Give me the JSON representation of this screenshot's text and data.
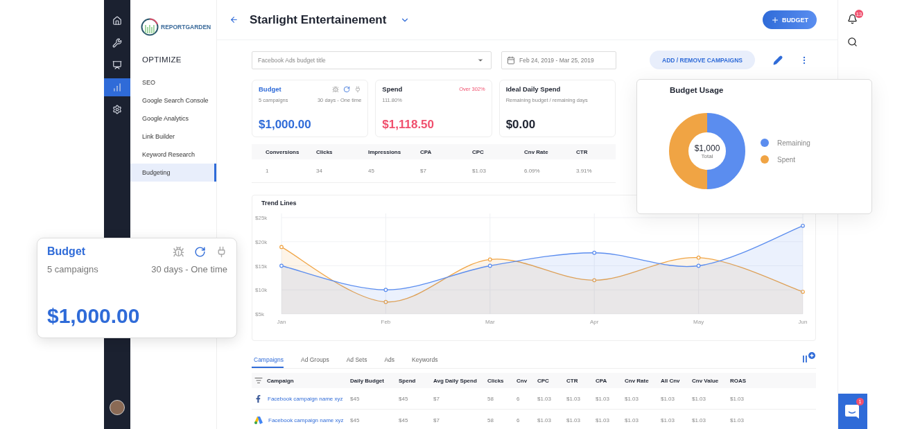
{
  "rail": {
    "items": [
      {
        "kind": "home",
        "selected": false
      },
      {
        "kind": "tools",
        "selected": false
      },
      {
        "kind": "reports",
        "selected": false
      },
      {
        "kind": "optimize",
        "selected": true
      },
      {
        "kind": "settings",
        "selected": false
      }
    ]
  },
  "brand": {
    "name": "REPORTGARDEN"
  },
  "sidebar": {
    "heading": "OPTIMIZE",
    "items": [
      {
        "label": "SEO",
        "selected": false
      },
      {
        "label": "Google Search Console",
        "selected": false
      },
      {
        "label": "Google Analytics",
        "selected": false
      },
      {
        "label": "Link Builder",
        "selected": false
      },
      {
        "label": "Keyword Research",
        "selected": false
      },
      {
        "label": "Budgeting",
        "selected": true
      }
    ]
  },
  "header": {
    "title": "Starlight Entertainement",
    "add_button": "BUDGET"
  },
  "toolbar": {
    "budget_select": {
      "placeholder": "Facebook Ads budget title"
    },
    "date_range": "Feb 24, 2019 - Mar 25, 2019",
    "campaigns_button": "ADD / REMOVE CAMPAIGNS"
  },
  "cards": [
    {
      "kind": "budget",
      "title": "Budget",
      "subtitle": "5 campaigns",
      "note": "30 days - One time",
      "value": "$1,000.00"
    },
    {
      "kind": "spend",
      "title": "Spend",
      "subtitle": "111.80%",
      "note": "Over 302%",
      "value": "$1,118.50"
    },
    {
      "kind": "ideal",
      "title": "Ideal Daily Spend",
      "subtitle": "Remaining budget / remaining days",
      "value": "$0.00"
    }
  ],
  "metrics": {
    "columns": [
      "Conversions",
      "Clicks",
      "Impressions",
      "CPA",
      "CPC",
      "Cnv Rate",
      "CTR"
    ],
    "row": [
      "1",
      "34",
      "45",
      "$7",
      "$1.03",
      "6.09%",
      "3.91%"
    ]
  },
  "trend": {
    "title": "Trend Lines",
    "chart_data": {
      "type": "area",
      "categories": [
        "Jan",
        "Feb",
        "Mar",
        "Apr",
        "May",
        "Jun"
      ],
      "series": [
        {
          "color": "#f0a444",
          "values": [
            18.9,
            7.5,
            16.3,
            12,
            16.7,
            9.6
          ]
        },
        {
          "color": "#5b8def",
          "values": [
            15,
            10,
            15,
            17.7,
            15,
            23.3
          ]
        }
      ],
      "ylim": [
        5,
        25
      ],
      "grid": true,
      "yticks": [
        {
          "value": 5,
          "label": "$5k"
        },
        {
          "value": 10,
          "label": "$10k"
        },
        {
          "value": 15,
          "label": "$15k"
        },
        {
          "value": 20,
          "label": "$20k"
        },
        {
          "value": 25,
          "label": "$25k"
        }
      ]
    }
  },
  "tabs": [
    {
      "label": "Campaigns",
      "selected": true
    },
    {
      "label": "Ad Groups",
      "selected": false
    },
    {
      "label": "Ad Sets",
      "selected": false
    },
    {
      "label": "Ads",
      "selected": false
    },
    {
      "label": "Keywords",
      "selected": false
    }
  ],
  "campaigns_table": {
    "columns": [
      "Campaign",
      "Daily Budget",
      "Spend",
      "Avg Daily Spend",
      "Clicks",
      "Cnv",
      "CPC",
      "CTR",
      "CPA",
      "Cnv Rate",
      "All Cnv",
      "Cnv Value",
      "ROAS"
    ],
    "rows": [
      {
        "kind": "facebook",
        "cells": [
          "Facebook campaign name xyz",
          "$45",
          "$45",
          "$7",
          "58",
          "6",
          "$1.03",
          "$1.03",
          "$1.03",
          "$1.03",
          "$1.03",
          "$1.03",
          "$1.03"
        ]
      },
      {
        "kind": "google",
        "cells": [
          "Facebook campaign name xyz",
          "$45",
          "$45",
          "$7",
          "58",
          "6",
          "$1.03",
          "$1.03",
          "$1.03",
          "$1.03",
          "$1.03",
          "$1.03",
          "$1.03"
        ]
      }
    ]
  },
  "notifications": {
    "count": "13"
  },
  "chat": {
    "count": "1"
  },
  "budget_usage": {
    "title": "Budget Usage",
    "total": "$1,000",
    "total_label": "Total",
    "legend": [
      {
        "label": "Remaining",
        "color": "#5b8def"
      },
      {
        "label": "Spent",
        "color": "#f0a444"
      }
    ]
  },
  "floating_budget": {
    "kind": "budget",
    "title": "Budget",
    "subtitle": "5 campaigns",
    "note": "30 days - One time",
    "value": "$1,000.00"
  }
}
